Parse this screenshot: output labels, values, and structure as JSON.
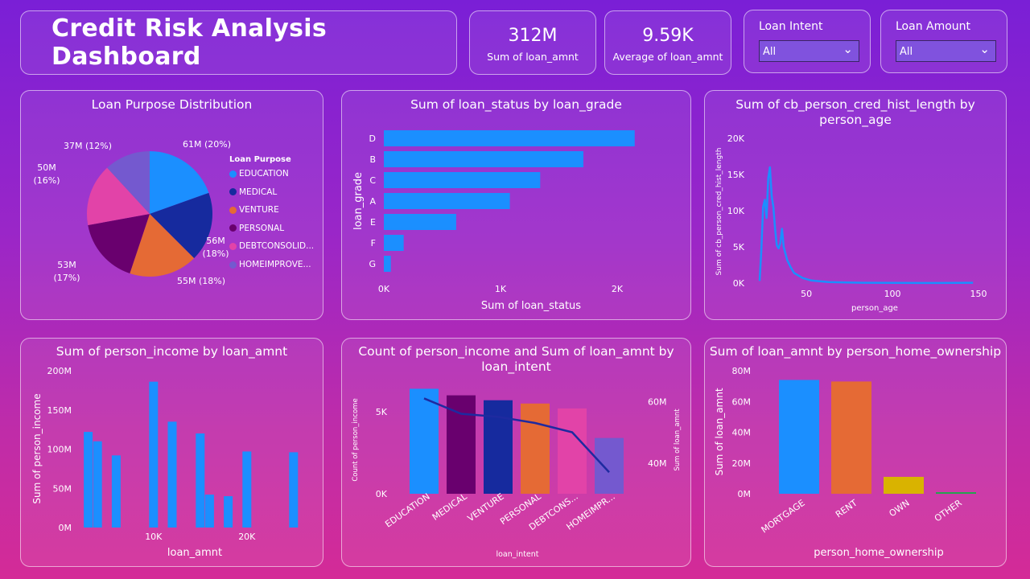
{
  "header": {
    "title": "Credit Risk Analysis Dashboard"
  },
  "kpis": [
    {
      "value": "312M",
      "label": "Sum of loan_amnt"
    },
    {
      "value": "9.59K",
      "label": "Average of loan_amnt"
    }
  ],
  "slicers": [
    {
      "label": "Loan Intent",
      "value": "All"
    },
    {
      "label": "Loan Amount",
      "value": "All"
    }
  ],
  "colors": {
    "blue": "#1b8fff",
    "navy": "#162a9e",
    "orange": "#e56a35",
    "purple": "#69006e",
    "pink": "#e243a8",
    "lavender": "#7459cf",
    "yellow": "#d9b300",
    "green": "#1ea84c",
    "line": "#1e2aa0"
  },
  "chart_data": [
    {
      "type": "pie",
      "title": "Loan Purpose Distribution",
      "legend_title": "Loan Purpose",
      "legend_position": "right",
      "slices": [
        {
          "label": "EDUCATION",
          "value": 61,
          "data_label": "61M (20%)"
        },
        {
          "label": "MEDICAL",
          "value": 56,
          "data_label": "56M (18%)"
        },
        {
          "label": "VENTURE",
          "value": 55,
          "data_label": "55M (18%)"
        },
        {
          "label": "PERSONAL",
          "value": 53,
          "data_label": "53M (17%)"
        },
        {
          "label": "DEBTCONSOLID...",
          "value": 50,
          "data_label": "50M (16%)"
        },
        {
          "label": "HOMEIMPROVE...",
          "value": 37,
          "data_label": "37M (12%)"
        }
      ]
    },
    {
      "type": "bar",
      "orientation": "horizontal",
      "title": "Sum of loan_status by loan_grade",
      "categories": [
        "D",
        "B",
        "C",
        "A",
        "E",
        "F",
        "G"
      ],
      "values": [
        2150,
        1710,
        1340,
        1080,
        620,
        170,
        60
      ],
      "xlabel": "Sum of loan_status",
      "ylabel": "loan_grade",
      "xticks": [
        "0K",
        "1K",
        "2K"
      ],
      "xlim": [
        0,
        2000
      ]
    },
    {
      "type": "line",
      "title": "Sum of cb_person_cred_hist_length by person_age",
      "xlabel": "person_age",
      "ylabel": "Sum of cb_person_cred_hist_length",
      "xlim": [
        20,
        150
      ],
      "ylim": [
        0,
        20000
      ],
      "xticks": [
        "50",
        "100",
        "150"
      ],
      "yticks": [
        "0K",
        "5K",
        "10K",
        "15K",
        "20K"
      ],
      "x": [
        20,
        21,
        22,
        23,
        24,
        25,
        26,
        27,
        28,
        29,
        30,
        31,
        32,
        33,
        34,
        36,
        38,
        40,
        45,
        50,
        60,
        70,
        80,
        100,
        123,
        144
      ],
      "y": [
        300,
        4500,
        10500,
        11500,
        9000,
        14500,
        16000,
        12000,
        10500,
        7500,
        5200,
        4800,
        5500,
        7500,
        5000,
        3200,
        2200,
        1400,
        700,
        350,
        150,
        80,
        40,
        20,
        10,
        50
      ]
    },
    {
      "type": "bar",
      "title": "Sum of person_income by loan_amnt",
      "xlabel": "loan_amnt",
      "ylabel": "Sum of person_income",
      "ylim": [
        0,
        200
      ],
      "yticks": [
        "0M",
        "50M",
        "100M",
        "150M",
        "200M"
      ],
      "xticks": [
        "10K",
        "20K"
      ],
      "xlim": [
        2000,
        27000
      ],
      "x": [
        3000,
        4000,
        6000,
        10000,
        12000,
        15000,
        16000,
        18000,
        20000,
        25000
      ],
      "values": [
        122,
        110,
        92,
        186,
        135,
        120,
        42,
        40,
        97,
        96
      ]
    },
    {
      "type": "bar",
      "title": "Count of person_income and Sum of loan_amnt by loan_intent",
      "categories": [
        "EDUCATION",
        "MEDICAL",
        "VENTURE",
        "PERSONAL",
        "DEBTCONS...",
        "HOMEIMPR..."
      ],
      "xlabel": "loan_intent",
      "series": [
        {
          "name": "Count of person_income",
          "values": [
            6400,
            6000,
            5700,
            5500,
            5200,
            3400
          ]
        },
        {
          "name": "Sum of loan_amnt",
          "values": [
            61,
            56,
            55,
            53,
            50,
            37
          ]
        }
      ],
      "ylabel": "Count of person_income",
      "ylabel_right": "Sum of loan_amnt",
      "yticks": [
        "0K",
        "5K"
      ],
      "yticks_right": [
        "40M",
        "60M"
      ],
      "ylim": [
        0,
        7500
      ],
      "ylim_right": [
        30,
        70
      ]
    },
    {
      "type": "bar",
      "title": "Sum of loan_amnt by person_home_ownership",
      "categories": [
        "MORTGAGE",
        "RENT",
        "OWN",
        "OTHER"
      ],
      "values": [
        74,
        73,
        11,
        1
      ],
      "xlabel": "person_home_ownership",
      "ylabel": "Sum of loan_amnt",
      "ylim": [
        0,
        80
      ],
      "yticks": [
        "0M",
        "20M",
        "40M",
        "60M",
        "80M"
      ]
    }
  ]
}
